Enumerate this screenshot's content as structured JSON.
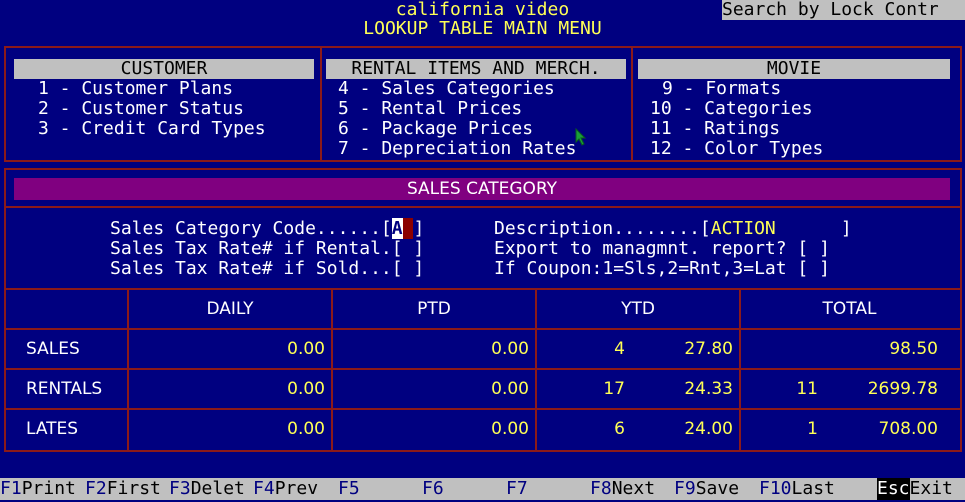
{
  "header": {
    "app_title": "california video",
    "menu_title": "LOOKUP TABLE MAIN MENU",
    "search_label": "Search by Lock Contr"
  },
  "menu": {
    "customer": {
      "title": "CUSTOMER",
      "items": [
        "1 - Customer Plans",
        "2 - Customer Status",
        "3 - Credit Card Types"
      ]
    },
    "rental": {
      "title": "RENTAL ITEMS AND MERCH.",
      "items": [
        "4 - Sales Categories",
        "5 - Rental Prices",
        "6 - Package Prices",
        "7 - Depreciation Rates"
      ]
    },
    "movie": {
      "title": "MOVIE",
      "items": [
        "9 - Formats",
        "10 - Categories",
        "11 - Ratings",
        "12 - Color Types"
      ]
    }
  },
  "form": {
    "title": "SALES CATEGORY",
    "code_label": "Sales Category Code......[",
    "code_value": "A",
    "code_tail": " ",
    "code_close": "]",
    "desc_label": "Description........[",
    "desc_value": "ACTION",
    "desc_close": "]",
    "rental_tax_label": "Sales Tax Rate# if Rental.[ ]",
    "export_label": "Export to managmnt. report? [ ]",
    "sold_tax_label": "Sales Tax Rate# if Sold...[ ]",
    "coupon_label": "If Coupon:1=Sls,2=Rnt,3=Lat [ ]"
  },
  "table": {
    "columns": [
      "DAILY",
      "PTD",
      "YTD",
      "TOTAL"
    ],
    "rows": [
      {
        "label": "SALES",
        "daily": "0.00",
        "ptd": "0.00",
        "ytd_count": "4",
        "ytd": "27.80",
        "total_count": "",
        "total": "98.50"
      },
      {
        "label": "RENTALS",
        "daily": "0.00",
        "ptd": "0.00",
        "ytd_count": "17",
        "ytd": "24.33",
        "total_count": "11",
        "total": "2699.78"
      },
      {
        "label": "LATES",
        "daily": "0.00",
        "ptd": "0.00",
        "ytd_count": "6",
        "ytd": "24.00",
        "total_count": "1",
        "total": "708.00"
      }
    ]
  },
  "fkeys": [
    {
      "code": "F1",
      "label": "Print"
    },
    {
      "code": "F2",
      "label": "First"
    },
    {
      "code": "F3",
      "label": "Delet"
    },
    {
      "code": "F4",
      "label": "Prev"
    },
    {
      "code": "F5",
      "label": ""
    },
    {
      "code": "F6",
      "label": ""
    },
    {
      "code": "F7",
      "label": ""
    },
    {
      "code": "F8",
      "label": "Next"
    },
    {
      "code": "F9",
      "label": "Save"
    },
    {
      "code": "F10",
      "label": "Last"
    },
    {
      "code": "Esc",
      "label": "Exit"
    }
  ],
  "colors": {
    "background": "#000080",
    "highlight": "#ffff55",
    "frame": "#8b1a1a",
    "band": "#800080",
    "bar": "#c0c0c0"
  }
}
